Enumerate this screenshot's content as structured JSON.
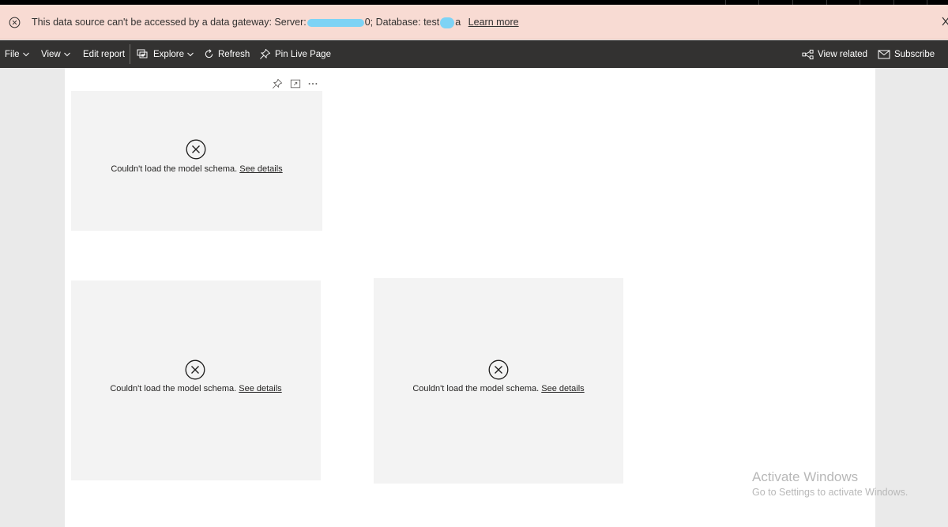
{
  "banner": {
    "message_prefix": "This data source can't be accessed by a data gateway: Server:",
    "server_suffix": "0",
    "database_label": "; Database: test",
    "database_suffix": "a",
    "learn_more": "Learn more"
  },
  "toolbar": {
    "file": "File",
    "view": "View",
    "edit_report": "Edit report",
    "explore": "Explore",
    "refresh": "Refresh",
    "pin_live_page": "Pin Live Page",
    "view_related": "View related",
    "subscribe": "Subscribe"
  },
  "visuals": [
    {
      "message": "Couldn't load the model schema.",
      "link": "See details"
    },
    {
      "message": "Couldn't load the model schema.",
      "link": "See details"
    },
    {
      "message": "Couldn't load the model schema.",
      "link": "See details"
    }
  ],
  "watermark": {
    "title": "Activate Windows",
    "subtitle": "Go to Settings to activate Windows."
  },
  "colors": {
    "banner_bg": "#f8dbd3",
    "toolbar_bg": "#333231",
    "visual_bg": "#f3f3f3",
    "redaction": "#7dd3f5"
  },
  "icons": [
    "error-circle-icon",
    "close-icon",
    "chevron-down-icon",
    "explore-icon",
    "refresh-icon",
    "pin-icon",
    "share-icon",
    "mail-icon",
    "focus-mode-icon",
    "more-options-icon"
  ]
}
